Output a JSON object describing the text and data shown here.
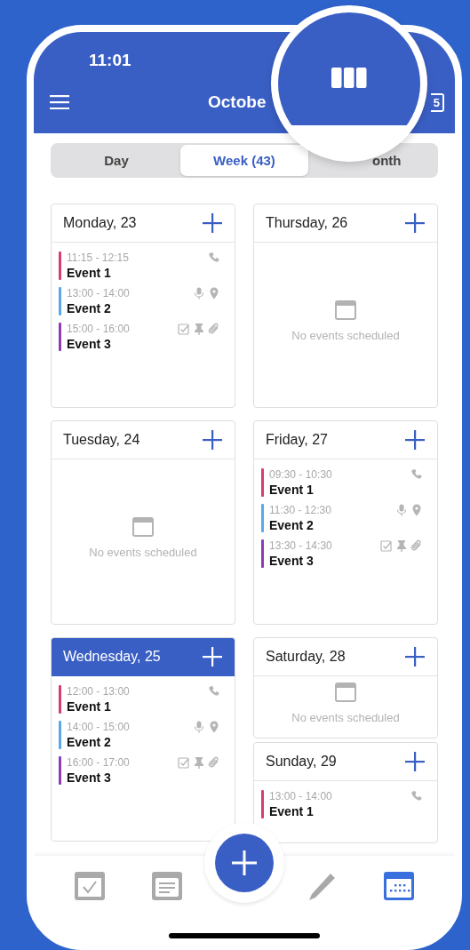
{
  "status_bar": {
    "time": "11:01"
  },
  "header": {
    "title": "Octobe",
    "date_badge": "5"
  },
  "view_tabs": [
    {
      "label": "Day",
      "selected": false
    },
    {
      "label": "Week (43)",
      "selected": true
    },
    {
      "label": "onth",
      "selected": false
    }
  ],
  "day_columns": [
    {
      "days": [
        {
          "title": "Monday, 23",
          "selected": false,
          "events": [
            {
              "time": "11:15 - 12:15",
              "title": "Event 1",
              "color": "#d63e6e",
              "call": true,
              "mic": false,
              "location": false,
              "task": false,
              "pin": false,
              "attachment": false
            },
            {
              "time": "13:00 - 14:00",
              "title": "Event 2",
              "color": "#5aa8e8",
              "call": false,
              "mic": true,
              "location": true,
              "task": false,
              "pin": false,
              "attachment": false
            },
            {
              "time": "15:00 - 16:00",
              "title": "Event 3",
              "color": "#8e3bb8",
              "call": false,
              "mic": false,
              "location": false,
              "task": true,
              "pin": true,
              "attachment": true
            }
          ]
        },
        {
          "title": "Tuesday, 24",
          "selected": false,
          "empty_text": "No events scheduled"
        },
        {
          "title": "Wednesday, 25",
          "selected": true,
          "events": [
            {
              "time": "12:00 - 13:00",
              "title": "Event 1",
              "color": "#d63e6e",
              "call": true,
              "mic": false,
              "location": false,
              "task": false,
              "pin": false,
              "attachment": false
            },
            {
              "time": "14:00 - 15:00",
              "title": "Event 2",
              "color": "#5aa8e8",
              "call": false,
              "mic": true,
              "location": true,
              "task": false,
              "pin": false,
              "attachment": false
            },
            {
              "time": "16:00 - 17:00",
              "title": "Event 3",
              "color": "#8e3bb8",
              "call": false,
              "mic": false,
              "location": false,
              "task": true,
              "pin": true,
              "attachment": true
            }
          ]
        }
      ]
    },
    {
      "days": [
        {
          "title": "Thursday, 26",
          "selected": false,
          "empty_text": "No events scheduled"
        },
        {
          "title": "Friday, 27",
          "selected": false,
          "events": [
            {
              "time": "09:30 - 10:30",
              "title": "Event 1",
              "color": "#d63e6e",
              "call": true,
              "mic": false,
              "location": false,
              "task": false,
              "pin": false,
              "attachment": false
            },
            {
              "time": "11:30 - 12:30",
              "title": "Event 2",
              "color": "#5aa8e8",
              "call": false,
              "mic": true,
              "location": true,
              "task": false,
              "pin": false,
              "attachment": false
            },
            {
              "time": "13:30 - 14:30",
              "title": "Event 3",
              "color": "#8e3bb8",
              "call": false,
              "mic": false,
              "location": false,
              "task": true,
              "pin": true,
              "attachment": true
            }
          ]
        },
        {
          "title": "Saturday, 28",
          "selected": false,
          "empty_text": "No events scheduled"
        },
        {
          "title": "Sunday, 29",
          "selected": false,
          "events": [
            {
              "time": "13:00 - 14:00",
              "title": "Event 1",
              "color": "#d63e6e",
              "call": true,
              "mic": false,
              "location": false,
              "task": false,
              "pin": false,
              "attachment": false
            }
          ]
        }
      ]
    }
  ],
  "bottom_nav": [
    {
      "kind": "tasks",
      "selected": false
    },
    {
      "kind": "notes",
      "selected": false
    },
    {
      "kind": "add",
      "selected": false
    },
    {
      "kind": "edit",
      "selected": false
    },
    {
      "kind": "calendar",
      "selected": true
    }
  ]
}
